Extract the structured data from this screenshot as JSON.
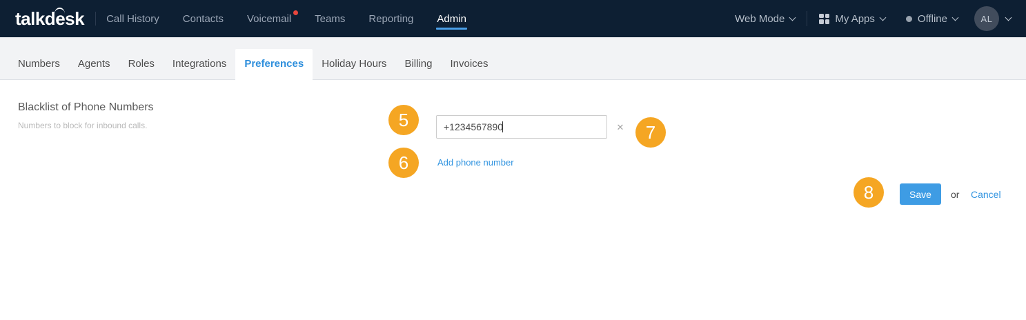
{
  "colors": {
    "navbar_bg": "#0D1F33",
    "accent_blue": "#3E9CE4",
    "link_blue": "#2F93E0",
    "active_tab_blue": "#2F8FDC",
    "annotation_orange": "#F5A623",
    "badge_red": "#E8463D"
  },
  "topnav": {
    "logo_prefix": "talkd",
    "logo_e": "e",
    "logo_suffix": "sk",
    "items": [
      {
        "label": "Call History"
      },
      {
        "label": "Contacts"
      },
      {
        "label": "Voicemail",
        "has_badge": true
      },
      {
        "label": "Teams"
      },
      {
        "label": "Reporting"
      },
      {
        "label": "Admin",
        "active": true
      }
    ],
    "web_mode_label": "Web Mode",
    "my_apps_label": "My Apps",
    "presence_label": "Offline",
    "avatar_initials": "AL"
  },
  "tabbar": {
    "tabs": [
      {
        "label": "Numbers"
      },
      {
        "label": "Agents"
      },
      {
        "label": "Roles"
      },
      {
        "label": "Integrations"
      },
      {
        "label": "Preferences",
        "active": true
      },
      {
        "label": "Holiday Hours"
      },
      {
        "label": "Billing"
      },
      {
        "label": "Invoices"
      }
    ]
  },
  "main": {
    "section_title": "Blacklist of Phone Numbers",
    "section_description": "Numbers to block for inbound calls.",
    "phone_input": {
      "value": "+1234567890"
    },
    "remove_glyph": "✕",
    "add_phone_link": "Add phone number",
    "save_label": "Save",
    "or_label": "or",
    "cancel_label": "Cancel"
  },
  "annotations": [
    {
      "number": "5"
    },
    {
      "number": "6"
    },
    {
      "number": "7"
    },
    {
      "number": "8"
    }
  ]
}
